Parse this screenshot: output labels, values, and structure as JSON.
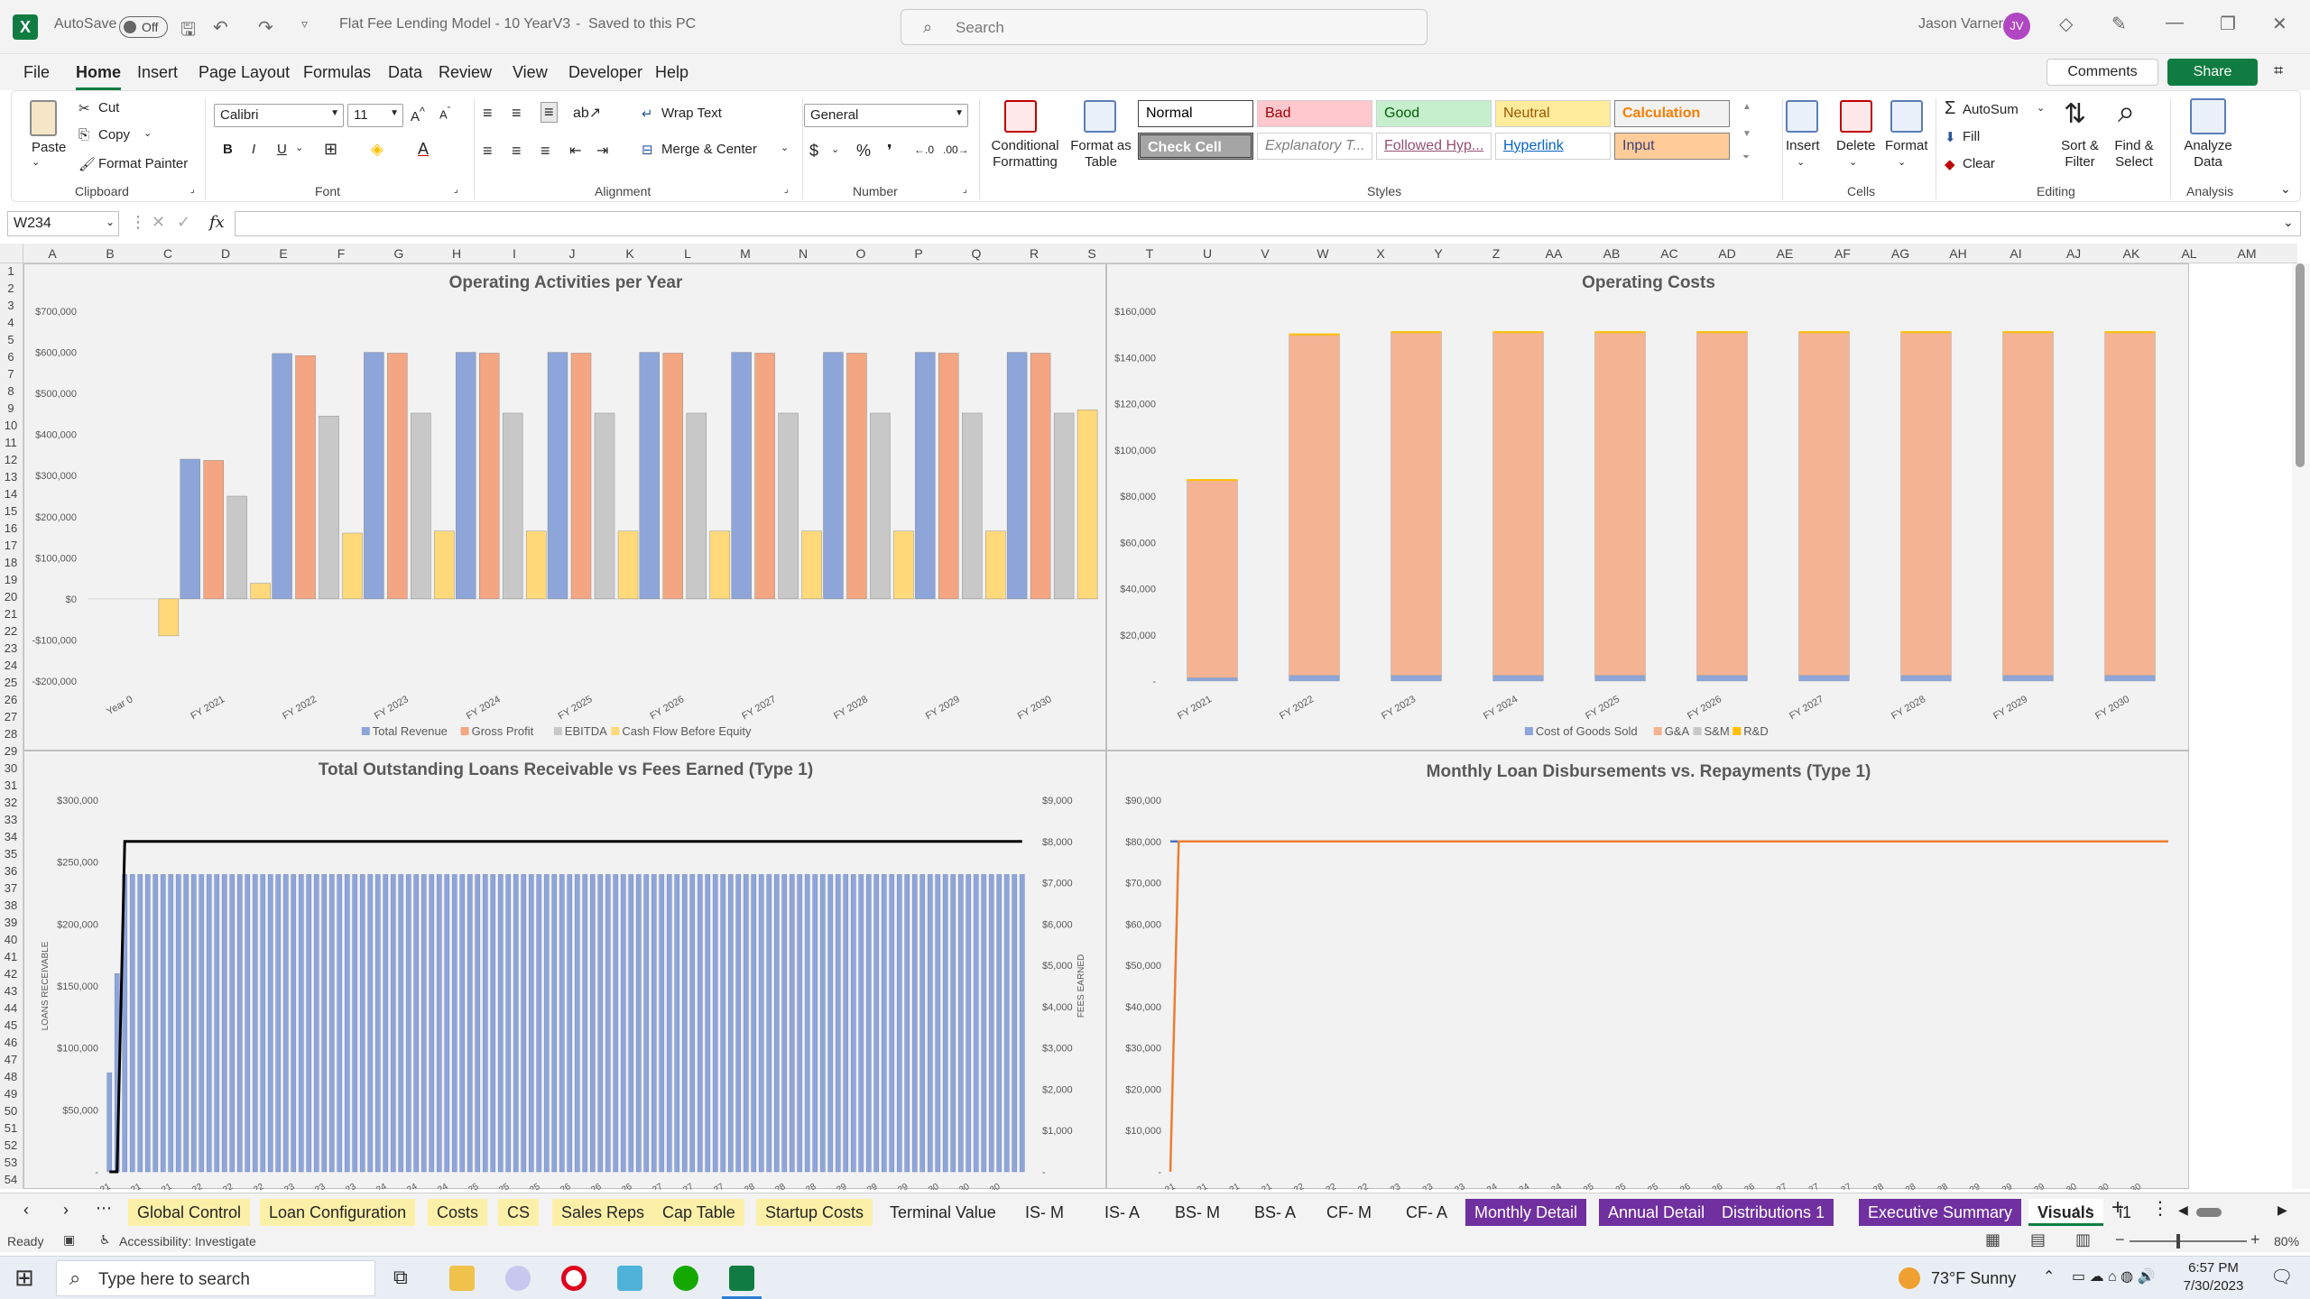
{
  "titlebar": {
    "autosave_label": "AutoSave",
    "autosave_state": "Off",
    "doc_title": "Flat Fee Lending Model - 10 YearV3",
    "save_status": "Saved to this PC",
    "search_placeholder": "Search",
    "user_name": "Jason Varner",
    "user_initials": "JV"
  },
  "menu": {
    "items": [
      "File",
      "Home",
      "Insert",
      "Page Layout",
      "Formulas",
      "Data",
      "Review",
      "View",
      "Developer",
      "Help"
    ],
    "active": "Home",
    "comments_label": "Comments",
    "share_label": "Share"
  },
  "ribbon": {
    "clipboard": {
      "paste": "Paste",
      "cut": "Cut",
      "copy": "Copy",
      "format_painter": "Format Painter",
      "label": "Clipboard"
    },
    "font": {
      "name": "Calibri",
      "size": "11",
      "label": "Font"
    },
    "alignment": {
      "wrap_text": "Wrap Text",
      "merge_center": "Merge & Center",
      "label": "Alignment"
    },
    "number": {
      "format": "General",
      "label": "Number"
    },
    "styles": {
      "conditional_formatting": "Conditional Formatting",
      "format_as_table": "Format as Table",
      "cells": [
        {
          "label": "Normal",
          "bg": "#ffffff",
          "fg": "#000000"
        },
        {
          "label": "Bad",
          "bg": "#ffc7ce",
          "fg": "#9c0006"
        },
        {
          "label": "Good",
          "bg": "#c6efce",
          "fg": "#006100"
        },
        {
          "label": "Neutral",
          "bg": "#ffeb9c",
          "fg": "#9c5700"
        },
        {
          "label": "Calculation",
          "bg": "#f2f2f2",
          "fg": "#fa7d00"
        },
        {
          "label": "Check Cell",
          "bg": "#a5a5a5",
          "fg": "#ffffff"
        },
        {
          "label": "Explanatory T...",
          "bg": "#ffffff",
          "fg": "#7f7f7f"
        },
        {
          "label": "Followed Hyp...",
          "bg": "#ffffff",
          "fg": "#954f72"
        },
        {
          "label": "Hyperlink",
          "bg": "#ffffff",
          "fg": "#0563c1"
        },
        {
          "label": "Input",
          "bg": "#ffcc99",
          "fg": "#3f3f76"
        }
      ],
      "label": "Styles"
    },
    "cells": {
      "insert": "Insert",
      "delete": "Delete",
      "format": "Format",
      "label": "Cells"
    },
    "editing": {
      "autosum": "AutoSum",
      "fill": "Fill",
      "clear": "Clear",
      "sort_filter": "Sort & Filter",
      "find_select": "Find & Select",
      "label": "Editing"
    },
    "analysis": {
      "analyze_data": "Analyze Data",
      "label": "Analysis"
    }
  },
  "formula_bar": {
    "name_box": "W234",
    "fx": "fx",
    "value": ""
  },
  "columns": [
    "A",
    "B",
    "C",
    "D",
    "E",
    "F",
    "G",
    "H",
    "I",
    "J",
    "K",
    "L",
    "M",
    "N",
    "O",
    "P",
    "Q",
    "R",
    "S",
    "T",
    "U",
    "V",
    "W",
    "X",
    "Y",
    "Z",
    "AA",
    "AB",
    "AC",
    "AD",
    "AE",
    "AF",
    "AG",
    "AH",
    "AI",
    "AJ",
    "AK",
    "AL",
    "AM"
  ],
  "rows_from": 1,
  "rows_to": 54,
  "chart_data": [
    {
      "type": "bar",
      "title": "Operating Activities per Year",
      "categories": [
        "Year 0",
        "FY 2021",
        "FY 2022",
        "FY 2023",
        "FY 2024",
        "FY 2025",
        "FY 2026",
        "FY 2027",
        "FY 2028",
        "FY 2029",
        "FY 2030"
      ],
      "y_ticks": [
        "$700,000",
        "$600,000",
        "$500,000",
        "$400,000",
        "$300,000",
        "$200,000",
        "$100,000",
        "$0",
        "-$100,000",
        "-$200,000"
      ],
      "ylim": [
        -200000,
        700000
      ],
      "series": [
        {
          "name": "Total Revenue",
          "color": "#8ea5d9",
          "values": [
            0,
            340000,
            597000,
            600000,
            600000,
            600000,
            600000,
            600000,
            600000,
            600000,
            600000
          ]
        },
        {
          "name": "Gross Profit",
          "color": "#f4a582",
          "values": [
            0,
            337000,
            592000,
            598000,
            598000,
            598000,
            598000,
            598000,
            598000,
            598000,
            598000
          ]
        },
        {
          "name": "EBITDA",
          "color": "#c8c8c8",
          "values": [
            0,
            250000,
            445000,
            452000,
            452000,
            452000,
            452000,
            452000,
            452000,
            452000,
            452000
          ]
        },
        {
          "name": "Cash Flow Before Equity",
          "color": "#ffd97a",
          "values": [
            -90000,
            38000,
            160000,
            165000,
            165000,
            165000,
            165000,
            165000,
            165000,
            165000,
            460000
          ]
        }
      ],
      "legend": "bottom"
    },
    {
      "type": "bar",
      "stacked": true,
      "title": "Operating Costs",
      "categories": [
        "FY 2021",
        "FY 2022",
        "FY 2023",
        "FY 2024",
        "FY 2025",
        "FY 2026",
        "FY 2027",
        "FY 2028",
        "FY 2029",
        "FY 2030"
      ],
      "y_ticks": [
        "$160,000",
        "$140,000",
        "$120,000",
        "$100,000",
        "$80,000",
        "$60,000",
        "$40,000",
        "$20,000",
        "-"
      ],
      "ylim": [
        0,
        160000
      ],
      "series": [
        {
          "name": "Cost of Goods Sold",
          "color": "#8ea5d9",
          "values": [
            1500,
            2500,
            2500,
            2500,
            2500,
            2500,
            2500,
            2500,
            2500,
            2500
          ]
        },
        {
          "name": "G&A",
          "color": "#f4b393",
          "values": [
            85500,
            147500,
            148500,
            148500,
            148500,
            148500,
            148500,
            148500,
            148500,
            148500
          ]
        },
        {
          "name": "S&M",
          "color": "#c8c8c8",
          "values": [
            0,
            0,
            0,
            0,
            0,
            0,
            0,
            0,
            0,
            0
          ]
        },
        {
          "name": "R&D",
          "color": "#ffc000",
          "values": [
            0,
            0,
            0,
            0,
            0,
            0,
            0,
            0,
            0,
            0
          ]
        }
      ],
      "legend": "bottom"
    },
    {
      "type": "bar",
      "title": "Total Outstanding Loans Receivable vs Fees Earned (Type 1)",
      "ylabel": "LOANS RECEIVABLE",
      "y2label": "FEES EARNED",
      "y_ticks": [
        "$300,000",
        "$250,000",
        "$200,000",
        "$150,000",
        "$100,000",
        "$50,000",
        "-"
      ],
      "y2_ticks": [
        "$9,000",
        "$8,000",
        "$7,000",
        "$6,000",
        "$5,000",
        "$4,000",
        "$3,000",
        "$2,000",
        "$1,000",
        "-"
      ],
      "ylim": [
        0,
        300000
      ],
      "y2lim": [
        0,
        9000
      ],
      "x_ticks": [
        "-21",
        "-21",
        "-21",
        "-22",
        "-22",
        "-22",
        "-23",
        "-23",
        "-23",
        "-24",
        "-24",
        "-24",
        "-25",
        "-25",
        "-25",
        "-26",
        "-26",
        "-26",
        "-27",
        "-27",
        "-27",
        "-28",
        "-28",
        "-28",
        "-29",
        "-29",
        "-29",
        "-30",
        "-30",
        "-30"
      ],
      "series": [
        {
          "name": "Loans Receivable",
          "color": "#8ea5d9",
          "ramp": [
            80000,
            160000
          ],
          "steady": 240000,
          "count": 120
        },
        {
          "name": "Fees Earned",
          "color": "#000000",
          "ramp": [
            0,
            0
          ],
          "steady": 8000,
          "count": 120
        }
      ]
    },
    {
      "type": "line",
      "title": "Monthly Loan Disbursements vs. Repayments (Type 1)",
      "y_ticks": [
        "$90,000",
        "$80,000",
        "$70,000",
        "$60,000",
        "$50,000",
        "$40,000",
        "$30,000",
        "$20,000",
        "$10,000",
        "-"
      ],
      "ylim": [
        0,
        90000
      ],
      "x_ticks": [
        "-21",
        "-21",
        "-21",
        "-21",
        "-22",
        "-22",
        "-22",
        "-23",
        "-23",
        "-23",
        "-24",
        "-24",
        "-24",
        "-25",
        "-25",
        "-25",
        "-26",
        "-26",
        "-26",
        "-27",
        "-27",
        "-27",
        "-28",
        "-28",
        "-28",
        "-29",
        "-29",
        "-29",
        "-30",
        "-30",
        "-30"
      ],
      "series": [
        {
          "name": "Disbursements",
          "color": "#4472c4",
          "values_start": 80000,
          "steady": 80000,
          "count": 120
        },
        {
          "name": "Repayments",
          "color": "#ed7d31",
          "values_start": 0,
          "steady": 80000,
          "count": 120
        }
      ]
    }
  ],
  "tabs": [
    {
      "label": "Global Control",
      "style": "y"
    },
    {
      "label": "Loan Configuration",
      "style": "y"
    },
    {
      "label": "Costs",
      "style": "y"
    },
    {
      "label": "CS",
      "style": "y"
    },
    {
      "label": "Sales Reps",
      "style": "y"
    },
    {
      "label": "Cap Table",
      "style": "y"
    },
    {
      "label": "Startup Costs",
      "style": "y"
    },
    {
      "label": "Terminal Value",
      "style": ""
    },
    {
      "label": "IS- M",
      "style": ""
    },
    {
      "label": "IS- A",
      "style": ""
    },
    {
      "label": "BS- M",
      "style": ""
    },
    {
      "label": "BS- A",
      "style": ""
    },
    {
      "label": "CF- M",
      "style": ""
    },
    {
      "label": "CF- A",
      "style": ""
    },
    {
      "label": "Monthly Detail",
      "style": "p"
    },
    {
      "label": "Annual Detail",
      "style": "p"
    },
    {
      "label": "Distributions 1",
      "style": "p"
    },
    {
      "label": "Executive Summary",
      "style": "p"
    },
    {
      "label": "Visuals",
      "style": "active"
    },
    {
      "label": "i1",
      "style": ""
    }
  ],
  "status": {
    "ready": "Ready",
    "accessibility": "Accessibility: Investigate",
    "zoom": "80%"
  },
  "taskbar": {
    "search_placeholder": "Type here to search",
    "weather": "73°F  Sunny",
    "time": "6:57 PM",
    "date": "7/30/2023"
  }
}
